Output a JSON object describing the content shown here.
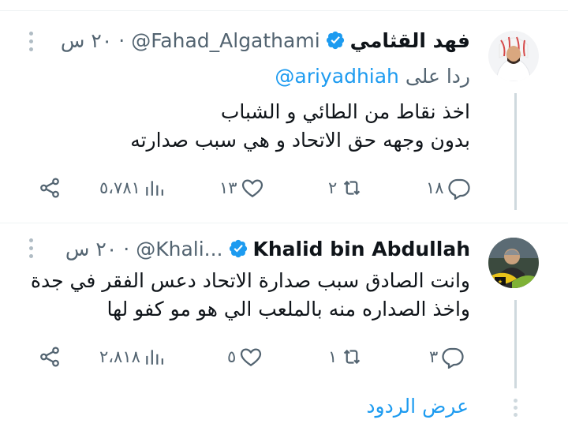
{
  "tweets": [
    {
      "name": "فهد القثامي",
      "handle": "@Fahad_Algathami",
      "time": "٢٠ س",
      "replying_label": "ردا على",
      "replying_to": "@ariyadhiah",
      "lines": [
        "اخذ نقاط من الطائي و الشباب",
        "بدون وجهه حق الاتحاد و هي سبب صدارته"
      ],
      "replies": "١٨",
      "retweets": "٢",
      "likes": "١٣",
      "views": "٥،٧٨١",
      "verified": true
    },
    {
      "name": "Khalid bin Abdullah",
      "handle": "@Khali...",
      "time": "٢٠ س",
      "lines": [
        "وانت الصادق سبب صدارة الاتحاد دعس الفقر في جدة",
        "واخذ الصداره منه بالملعب الي هو مو كفو لها"
      ],
      "replies": "٣",
      "retweets": "١",
      "likes": "٥",
      "views": "٢،٨١٨",
      "verified": true
    }
  ],
  "show_replies": "عرض الردود",
  "icons": {
    "reply": "reply-icon",
    "retweet": "retweet-icon",
    "like": "heart-icon",
    "views": "views-icon",
    "share": "share-icon",
    "verified": "verified-badge-icon",
    "more": "more-vertical-icon"
  },
  "colors": {
    "accent": "#1d9bf0",
    "text": "#0f1419",
    "secondary": "#536471"
  }
}
